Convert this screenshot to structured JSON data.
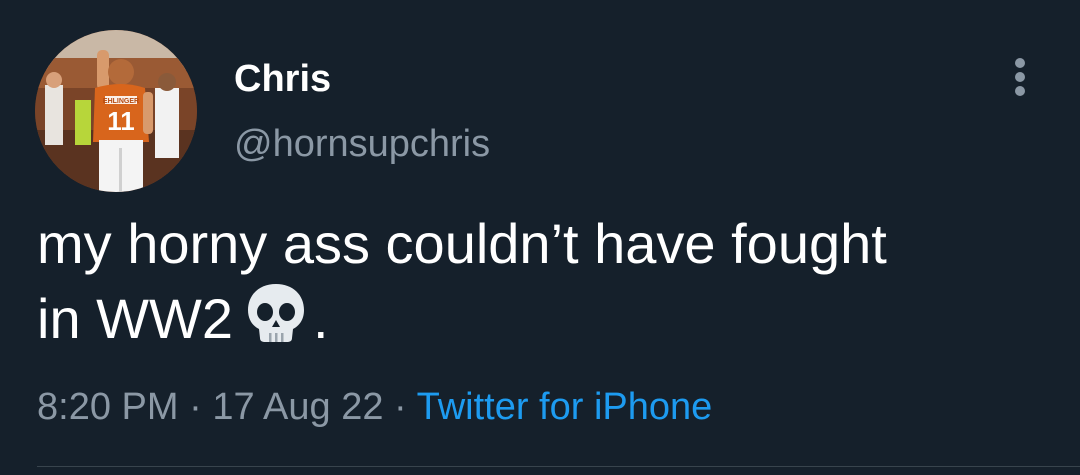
{
  "tweet": {
    "author": {
      "display_name": "Chris",
      "handle": "@hornsupchris",
      "avatar_icon": "football-player-avatar",
      "avatar_jersey_text": "EHLINGER",
      "avatar_jersey_number": "11"
    },
    "more_icon": "more-vertical-icon",
    "text_line_1": "my horny ass couldn’t have fought",
    "text_line_2_prefix": "in WW2",
    "text_emoji_icon": "skull-icon",
    "text_line_2_suffix": ".",
    "time": "8:20 PM",
    "separator_1": " · ",
    "date": "17 Aug 22",
    "separator_2": " · ",
    "source": "Twitter for iPhone"
  },
  "colors": {
    "background": "#15202b",
    "primary_text": "#ffffff",
    "secondary_text": "#8b98a5",
    "link": "#1d9bf0",
    "divider": "#38444d"
  }
}
